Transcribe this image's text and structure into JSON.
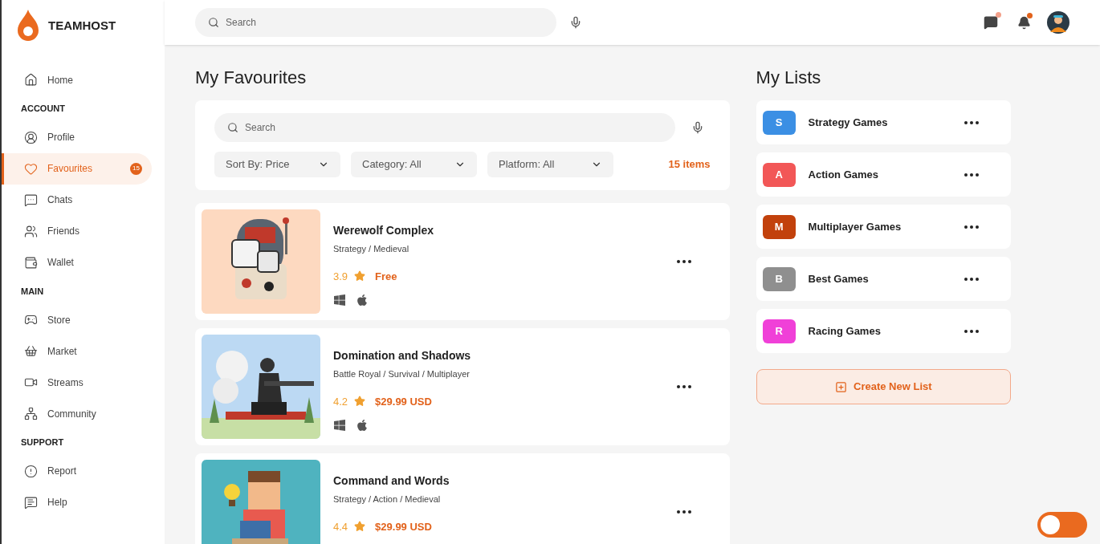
{
  "brand": {
    "name": "TEAMHOST"
  },
  "sidebar": {
    "sections": [
      {
        "items": [
          {
            "label": "Home",
            "selected": false
          }
        ]
      },
      {
        "heading": "ACCOUNT",
        "items": [
          {
            "label": "Profile",
            "selected": false
          },
          {
            "label": "Favourites",
            "selected": true,
            "badge": "15"
          },
          {
            "label": "Chats",
            "selected": false
          },
          {
            "label": "Friends",
            "selected": false
          },
          {
            "label": "Wallet",
            "selected": false
          }
        ]
      },
      {
        "heading": "MAIN",
        "items": [
          {
            "label": "Store",
            "selected": false
          },
          {
            "label": "Market",
            "selected": false
          },
          {
            "label": "Streams",
            "selected": false
          },
          {
            "label": "Community",
            "selected": false
          }
        ]
      },
      {
        "heading": "SUPPORT",
        "items": [
          {
            "label": "Report",
            "selected": false
          },
          {
            "label": "Help",
            "selected": false
          }
        ]
      }
    ]
  },
  "header": {
    "search": {
      "placeholder": "Search"
    },
    "chat_unread": true,
    "notifications_unread": true
  },
  "favourites": {
    "title": "My Favourites",
    "search": {
      "placeholder": "Search"
    },
    "filters": [
      {
        "value": "Sort By: Price"
      },
      {
        "value": "Category: All"
      },
      {
        "value": "Platform: All"
      }
    ],
    "count": "15 items",
    "games": [
      {
        "title": "Werewolf Complex",
        "genres": "Strategy / Medieval",
        "rating": "3.9",
        "price": "Free"
      },
      {
        "title": "Domination and Shadows",
        "genres": "Battle Royal / Survival / Multiplayer",
        "rating": "4.2",
        "price": "$29.99 USD"
      },
      {
        "title": "Command and Words",
        "genres": "Strategy / Action / Medieval",
        "rating": "4.4",
        "price": "$29.99 USD"
      }
    ]
  },
  "lists": {
    "title": "My Lists",
    "items": [
      {
        "letter": "S",
        "name": "Strategy Games",
        "color": "#3b8fe4"
      },
      {
        "letter": "A",
        "name": "Action Games",
        "color": "#f25757"
      },
      {
        "letter": "M",
        "name": "Multiplayer Games",
        "color": "#c2410c"
      },
      {
        "letter": "B",
        "name": "Best Games",
        "color": "#8f8f8f"
      },
      {
        "letter": "R",
        "name": "Racing Games",
        "color": "#f040d8"
      }
    ],
    "create_button": "Create New List"
  },
  "theme_toggle": {
    "on": false
  }
}
